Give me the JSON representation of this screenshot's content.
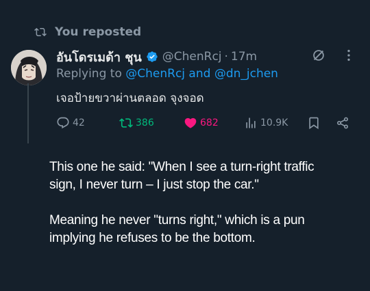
{
  "repost": {
    "label": "You reposted"
  },
  "tweet": {
    "display_name": "อันโดรเมด้า ชุน",
    "handle": "@ChenRcj",
    "separator": "·",
    "time": "17m",
    "replying_prefix": "Replying to ",
    "replying_mention_1": "@ChenRcj",
    "replying_and": " and ",
    "replying_mention_2": "@dn_jchen",
    "text": "เจอป้ายขวาผ่านตลอด จุงจอด"
  },
  "actions": {
    "replies": "42",
    "reposts": "386",
    "likes": "682",
    "views": "10.9K"
  },
  "caption": {
    "p1": "This one he said: \"When I see a turn-right traffic sign, I never turn – I just stop the car.\"",
    "p2": "Meaning he never \"turns right,\" which is a pun implying he refuses to be the bottom."
  },
  "colors": {
    "background": "#15202b",
    "secondary_text": "#8b98a5",
    "link": "#1d9bf0",
    "retweet": "#00ba7c",
    "like": "#f91880"
  }
}
